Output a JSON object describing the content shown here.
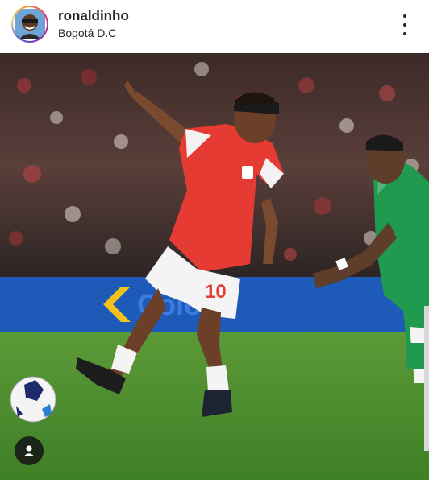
{
  "post": {
    "username": "ronaldinho",
    "location": "Bogotá D.C",
    "more_icon": "more-vertical-icon",
    "tag_icon": "user-tag-icon"
  },
  "photo": {
    "jersey_number": "10",
    "board_text": "Cololo"
  },
  "colors": {
    "home_kit": "#e63b32",
    "away_kit": "#1f9a4f",
    "pitch": "#4e8f2d",
    "board": "#1e5bb8"
  }
}
